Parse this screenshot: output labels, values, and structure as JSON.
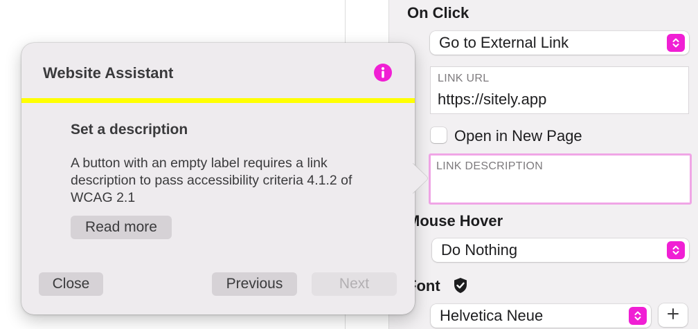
{
  "inspector": {
    "on_click_title": "On Click",
    "action_select": "Go to External Link",
    "link_url_label": "LINK URL",
    "link_url_value": "https://sitely.app",
    "open_new_page_label": "Open in New Page",
    "link_description_label": "LINK DESCRIPTION",
    "link_description_value": "",
    "mouse_hover_title": "Mouse Hover",
    "mouse_hover_select": "Do Nothing",
    "font_title": "Font",
    "font_select": "Helvetica Neue"
  },
  "assistant": {
    "title": "Website Assistant",
    "heading": "Set a description",
    "body": "A button with an empty label requires a link description to pass accessibility criteria 4.1.2 of WCAG 2.1",
    "read_more": "Read more",
    "close": "Close",
    "previous": "Previous",
    "next": "Next"
  },
  "colors": {
    "accent": "#f01fd4",
    "highlight_bar": "#ffff00",
    "focus_ring": "#f0a5e6"
  }
}
